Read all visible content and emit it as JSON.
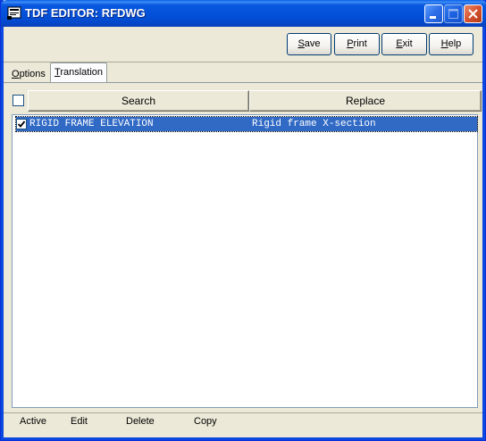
{
  "window": {
    "title": "TDF EDITOR: RFDWG"
  },
  "toolbar": {
    "save_label": "Save",
    "print_label": "Print",
    "exit_label": "Exit",
    "help_label": "Help"
  },
  "tabs": [
    {
      "label": "Options",
      "selected": false
    },
    {
      "label": "Translation",
      "selected": true
    }
  ],
  "grid": {
    "select_all_checked": false,
    "columns": [
      "Search",
      "Replace"
    ],
    "rows": [
      {
        "checked": true,
        "search": "RIGID FRAME ELEVATION",
        "replace": "Rigid frame X-section",
        "selected": true
      }
    ]
  },
  "statusbar": {
    "items": [
      "Active",
      "Edit",
      "Delete",
      "Copy"
    ]
  },
  "colors": {
    "titlebar": "#0350d8",
    "selection": "#316ac5",
    "window_bg": "#ece9d8",
    "close_button": "#d6532e"
  }
}
